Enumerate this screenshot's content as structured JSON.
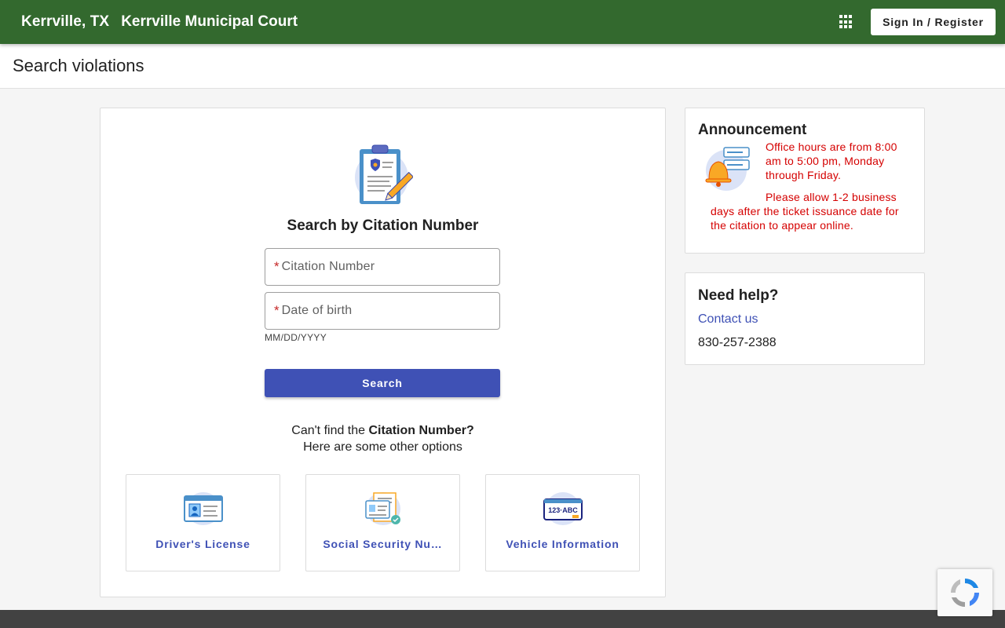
{
  "header": {
    "city": "Kerrville, TX",
    "court_name": "Kerrville Municipal Court",
    "apps_icon": "apps-grid-icon",
    "signin_label": "Sign In / Register",
    "bg_color": "#33692e"
  },
  "page": {
    "title": "Search violations"
  },
  "search": {
    "icon": "clipboard-badge-icon",
    "title": "Search by Citation Number",
    "citation_placeholder": "Citation Number",
    "dob_placeholder": "Date of birth",
    "required_mark": "*",
    "dob_hint": "MM/DD/YYYY",
    "button_label": "Search",
    "cant_find_prefix": "Can't find the ",
    "cant_find_bold": "Citation Number?",
    "other_options": "Here are some other options"
  },
  "options": [
    {
      "label": "Driver's License",
      "icon": "drivers-license-icon"
    },
    {
      "label": "Social Security Nu…",
      "icon": "social-security-card-icon"
    },
    {
      "label": "Vehicle Information",
      "icon": "license-plate-icon"
    }
  ],
  "announcement": {
    "title": "Announcement",
    "icon": "bell-icon",
    "line1": "Office hours are from 8:00 am to 5:00 pm, Monday through Friday.",
    "line2": "Please allow 1-2 business days after the ticket issuance date for the citation to appear online.",
    "text_color": "#d50000"
  },
  "help": {
    "title": "Need help?",
    "contact_label": "Contact us",
    "phone": "830-257-2388"
  },
  "colors": {
    "accent": "#3f51b5",
    "header": "#33692e",
    "required": "#c62828"
  }
}
